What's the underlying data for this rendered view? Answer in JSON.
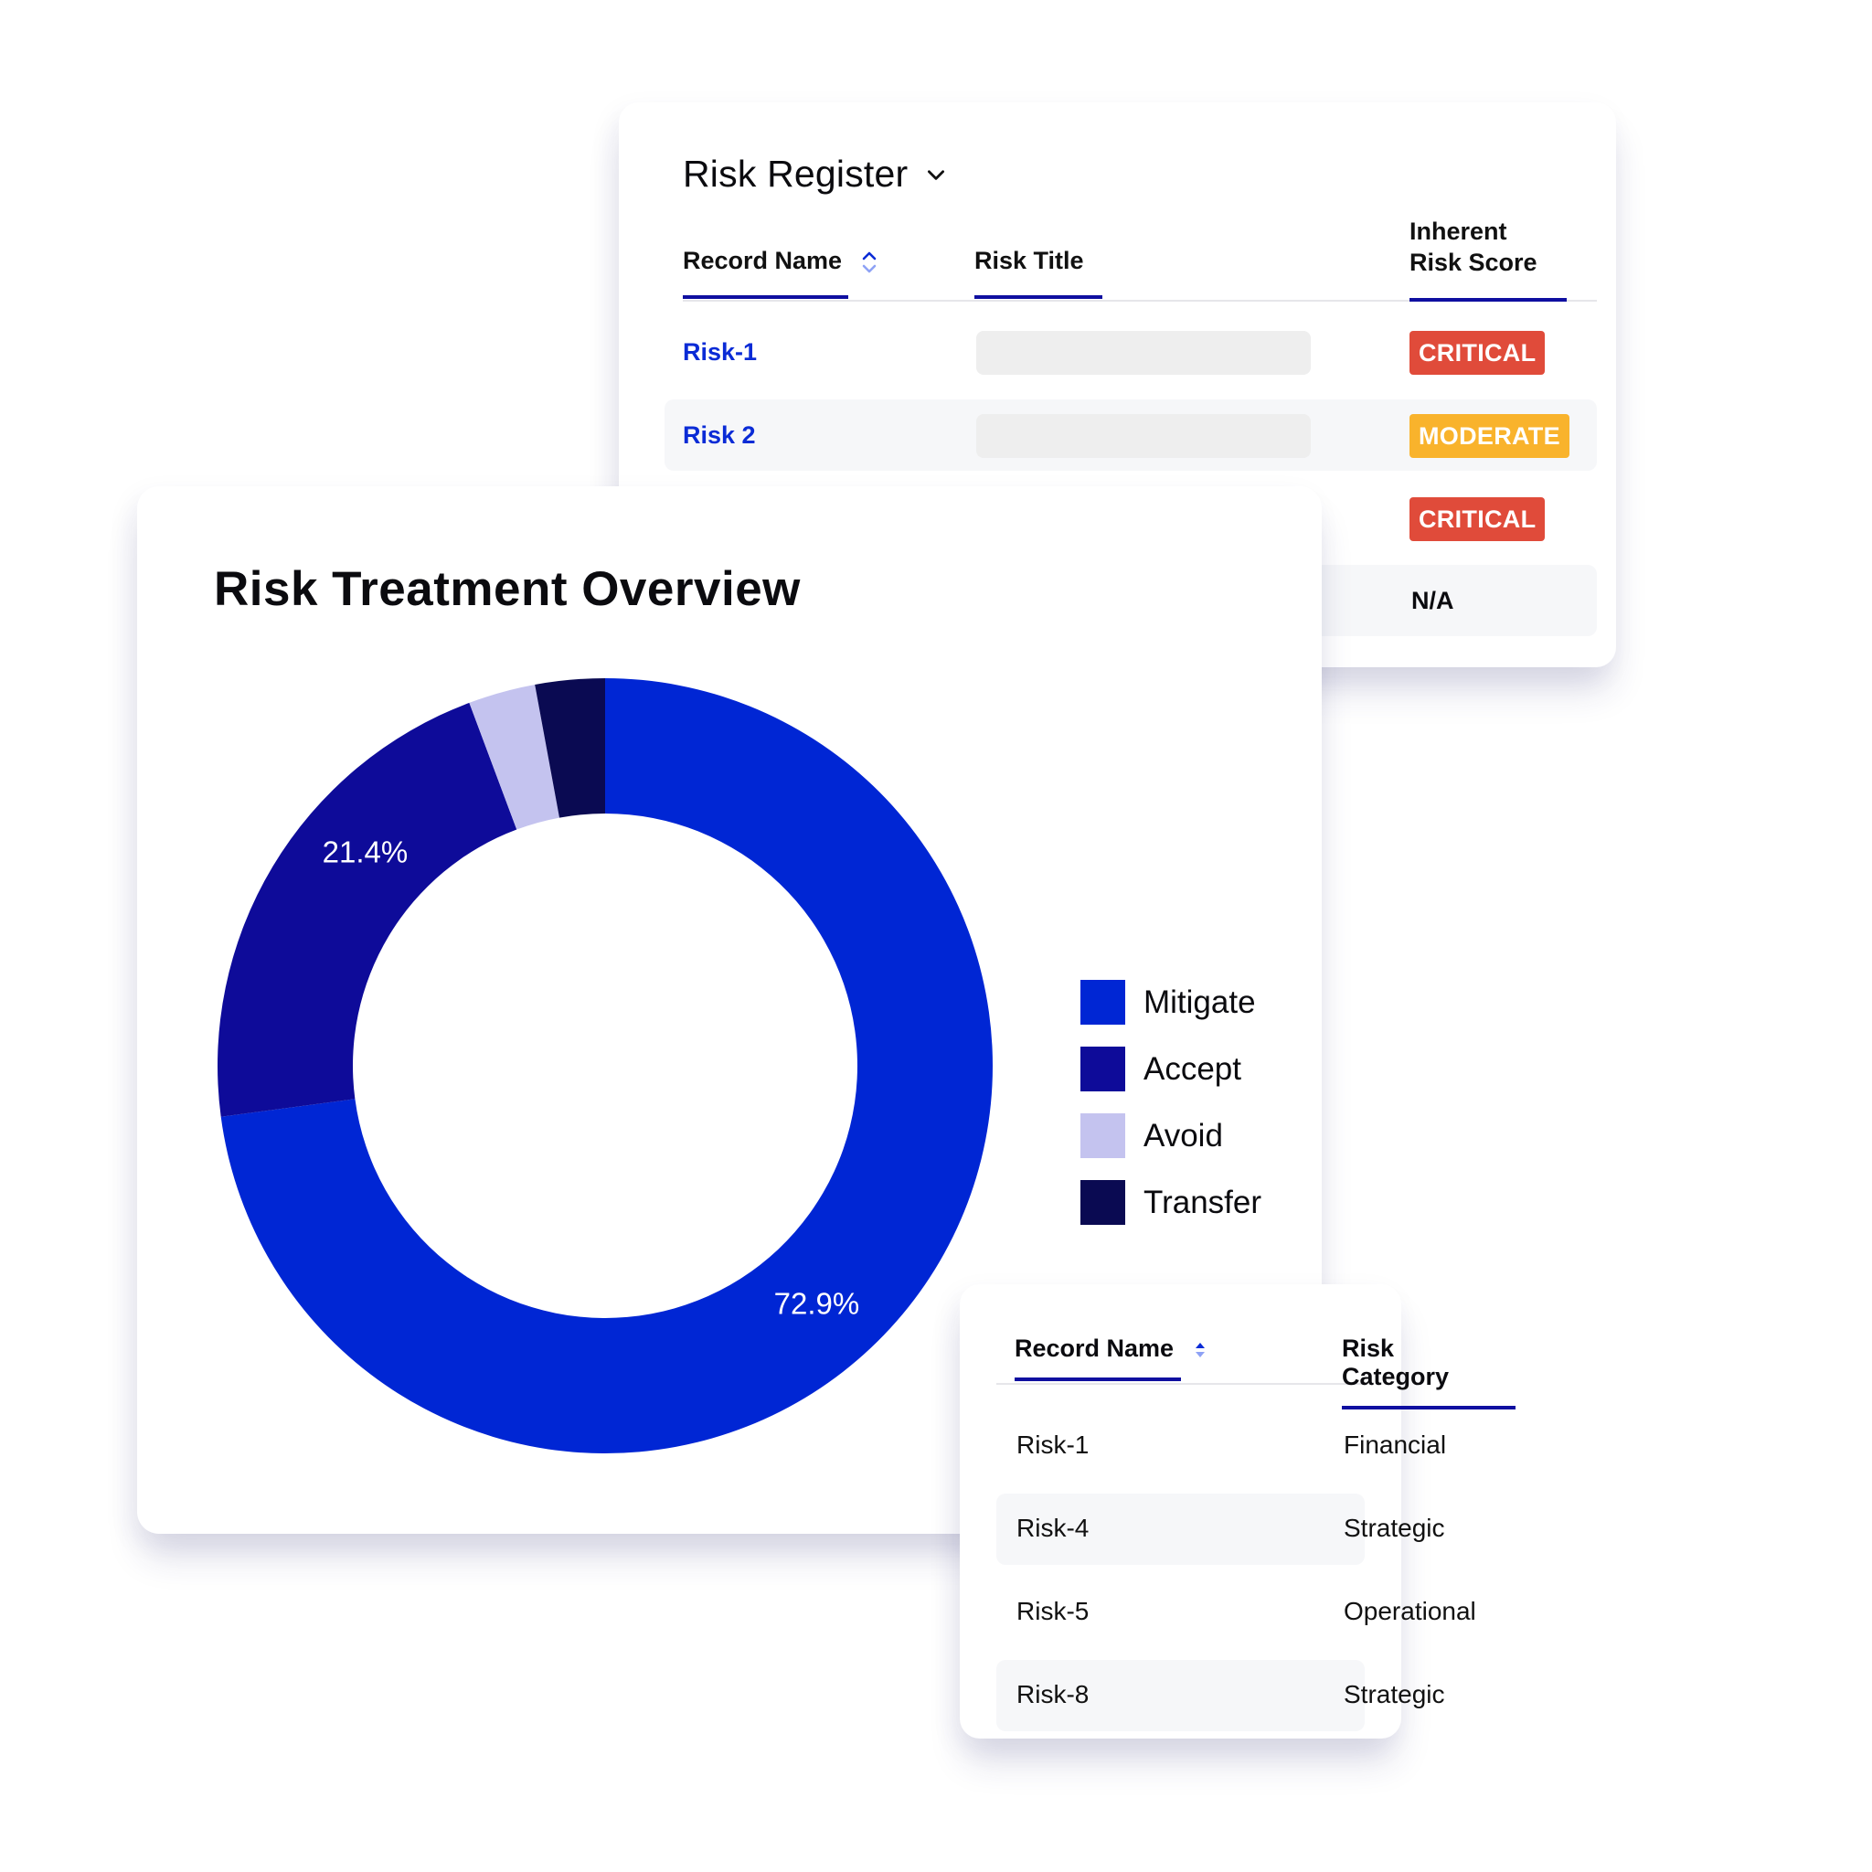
{
  "register": {
    "title": "Risk Register",
    "title_icon": "chevron-down-icon",
    "columns": [
      {
        "label": "Record Name",
        "sortable": true
      },
      {
        "label": "Risk Title",
        "sortable": false
      },
      {
        "label_line1": "Inherent",
        "label_line2": "Risk Score",
        "sortable": false
      }
    ],
    "rows": [
      {
        "record": "Risk-1",
        "title": "",
        "score": "CRITICAL",
        "score_color": "#e04b3a"
      },
      {
        "record": "Risk 2",
        "title": "",
        "score": "MODERATE",
        "score_color": "#f9b32c"
      },
      {
        "record": "",
        "title": "",
        "score": "CRITICAL",
        "score_color": "#e04b3a"
      },
      {
        "record": "",
        "title": "",
        "score": "N/A",
        "score_color": null
      }
    ]
  },
  "chart_card": {
    "title": "Risk Treatment Overview"
  },
  "chart_data": {
    "type": "pie",
    "variant": "donut",
    "title": "Risk Treatment Overview",
    "categories": [
      "Mitigate",
      "Accept",
      "Avoid",
      "Transfer"
    ],
    "values": [
      72.9,
      21.4,
      2.8,
      2.9
    ],
    "unit": "%",
    "colors": [
      "#0026d4",
      "#0e0b99",
      "#c4c3ef",
      "#0a0a52"
    ],
    "data_labels": [
      {
        "category": "Mitigate",
        "text": "72.9%"
      },
      {
        "category": "Accept",
        "text": "21.4%"
      }
    ],
    "start_angle": "12 o'clock",
    "direction": "clockwise",
    "legend": {
      "position": "right",
      "entries": [
        "Mitigate",
        "Accept",
        "Avoid",
        "Transfer"
      ]
    }
  },
  "category_table": {
    "columns": [
      {
        "label": "Record Name",
        "sortable": true
      },
      {
        "label": "Risk Category",
        "sortable": false
      }
    ],
    "rows": [
      {
        "record": "Risk-1",
        "category": "Financial"
      },
      {
        "record": "Risk-4",
        "category": "Strategic"
      },
      {
        "record": "Risk-5",
        "category": "Operational"
      },
      {
        "record": "Risk-8",
        "category": "Strategic"
      }
    ]
  },
  "colors": {
    "accent": "#0f0fa0",
    "link": "#0a2bd6",
    "critical": "#e04b3a",
    "moderate": "#f9b32c",
    "row_stripe": "#f6f7f9"
  }
}
